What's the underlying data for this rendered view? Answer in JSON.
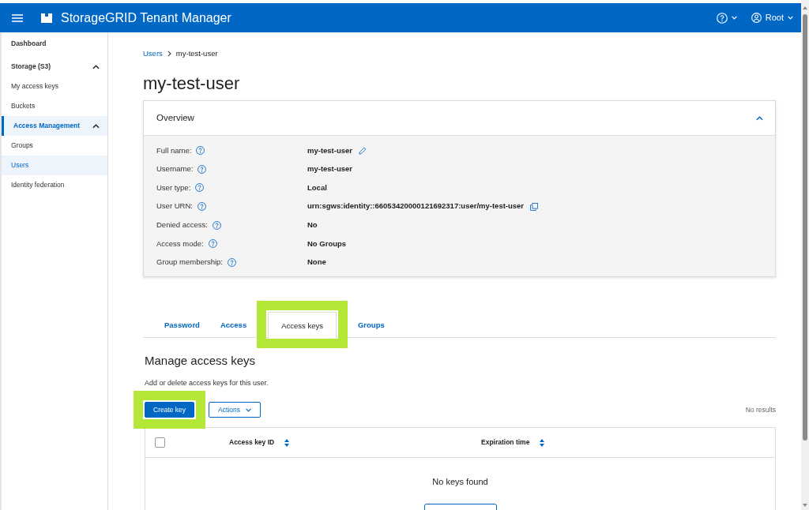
{
  "header": {
    "title": "StorageGRID Tenant Manager",
    "user": "Root"
  },
  "sidebar": {
    "items": [
      {
        "label": "Dashboard",
        "kind": "link",
        "selected": false
      },
      {
        "label": "Storage (S3)",
        "kind": "section",
        "selected": false,
        "expanded": true,
        "children": [
          {
            "label": "My access keys",
            "selected": false
          },
          {
            "label": "Buckets",
            "selected": false
          }
        ]
      },
      {
        "label": "Access Management",
        "kind": "section",
        "selected": true,
        "expanded": true,
        "children": [
          {
            "label": "Groups",
            "selected": false
          },
          {
            "label": "Users",
            "selected": true
          },
          {
            "label": "Identity federation",
            "selected": false
          }
        ]
      }
    ]
  },
  "breadcrumb": [
    {
      "label": "Users",
      "kind": "link"
    },
    {
      "label": "my-test-user",
      "kind": "current"
    }
  ],
  "page_title": "my-test-user",
  "overview": {
    "title": "Overview",
    "expanded": true,
    "fields": [
      {
        "label": "Full name:",
        "value": "my-test-user",
        "editable": true
      },
      {
        "label": "Username:",
        "value": "my-test-user"
      },
      {
        "label": "User type:",
        "value": "Local"
      },
      {
        "label": "User URN:",
        "value": "urn:sgws:identity::66053420000121692317:user/my-test-user",
        "copyable": true
      },
      {
        "label": "Denied access:",
        "value": "No"
      },
      {
        "label": "Access mode:",
        "value": "No Groups"
      },
      {
        "label": "Group membership:",
        "value": "None"
      }
    ]
  },
  "tabs": [
    {
      "label": "Password",
      "selected": false,
      "highlighted": false
    },
    {
      "label": "Access",
      "selected": false,
      "highlighted": false
    },
    {
      "label": "Access keys",
      "selected": true,
      "highlighted": true
    },
    {
      "label": "Groups",
      "selected": false,
      "highlighted": false
    }
  ],
  "section": {
    "title": "Manage access keys",
    "description": "Add or delete access keys for this user."
  },
  "toolbar": {
    "buttons": [
      {
        "label": "Create key",
        "kind": "primary",
        "highlighted": true
      },
      {
        "label": "Actions",
        "kind": "dropdown",
        "highlighted": false
      }
    ],
    "result_count": "No results"
  },
  "table": {
    "select_all_checked": false,
    "columns": [
      {
        "label": "Access key ID"
      },
      {
        "label": "Expiration time"
      }
    ],
    "empty_message": "No keys found"
  }
}
